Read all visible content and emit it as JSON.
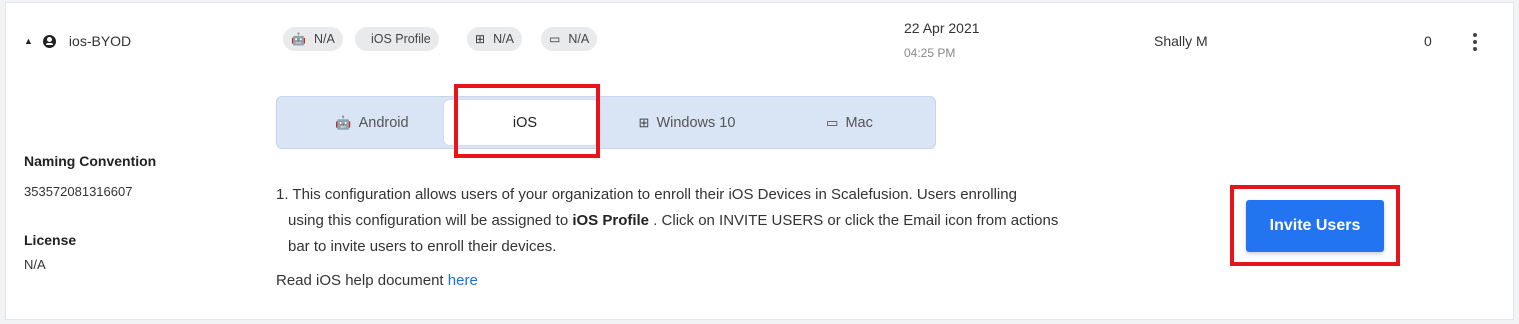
{
  "row": {
    "expand_icon": "caret-up-icon",
    "profile_icon": "account-circle-icon",
    "name": "ios-BYOD",
    "chips": [
      {
        "icon": "android-icon",
        "glyph": "🤖",
        "label": "N/A"
      },
      {
        "icon": "apple-icon",
        "glyph": "",
        "label": "iOS Profile"
      },
      {
        "icon": "windows-icon",
        "glyph": "⊞",
        "label": "N/A"
      },
      {
        "icon": "laptop-icon",
        "glyph": "▭",
        "label": "N/A"
      }
    ],
    "date": "22 Apr 2021",
    "time": "04:25 PM",
    "owner": "Shally M",
    "count": "0",
    "more_icon": "more-vertical-icon"
  },
  "details": {
    "naming_convention_label": "Naming Convention",
    "naming_convention_value": "353572081316607",
    "license_label": "License",
    "license_value": "N/A"
  },
  "tabs": [
    {
      "icon": "android-icon",
      "glyph": "🤖",
      "label": "Android"
    },
    {
      "icon": "apple-icon",
      "glyph": "",
      "label": "iOS",
      "active": true
    },
    {
      "icon": "windows-icon",
      "glyph": "⊞",
      "label": "Windows 10"
    },
    {
      "icon": "laptop-icon",
      "glyph": "▭",
      "label": "Mac"
    }
  ],
  "description": {
    "line1": "1. This configuration allows users of your organization to enroll their iOS Devices in Scalefusion. Users enrolling",
    "line2_pre": "using this configuration will be assigned to ",
    "line2_bold": "iOS Profile",
    "line2_post": " . Click on INVITE USERS or click the Email icon from actions",
    "line3": "bar to invite users to enroll their devices.",
    "help_text": "Read iOS help document ",
    "help_link": "here"
  },
  "invite_button": "Invite Users",
  "colors": {
    "accent": "#2374f0",
    "highlight": "#e8141c",
    "tab_bar": "#d9e4f5"
  }
}
